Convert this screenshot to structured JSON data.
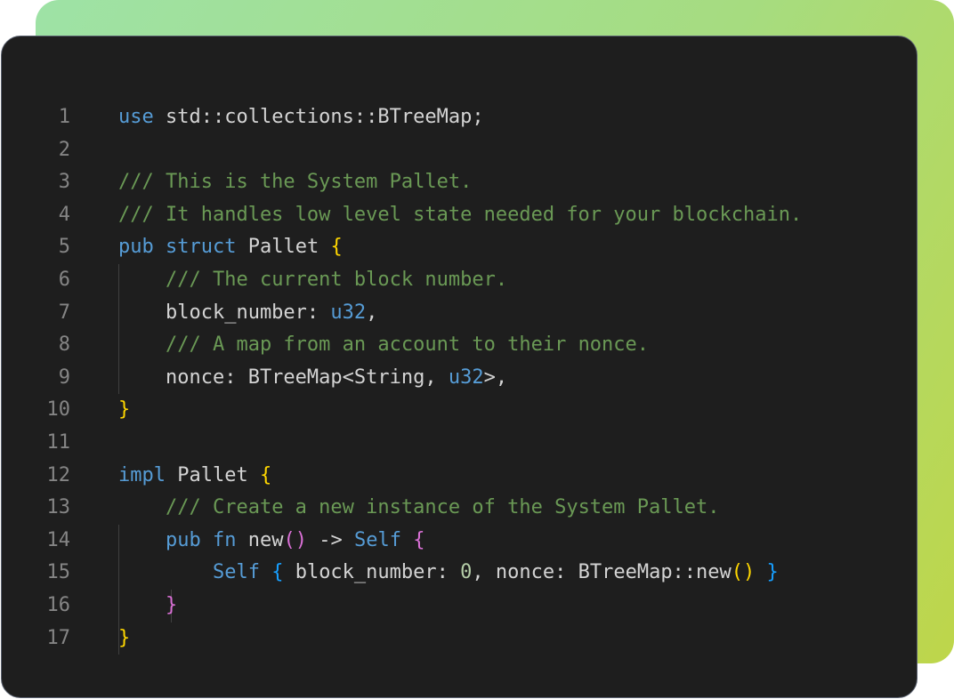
{
  "colors": {
    "background": "#1e1e1e",
    "keyword": "#569cd6",
    "comment": "#6a9955",
    "number": "#b5cea8",
    "text": "#d4d4d4",
    "line_number": "#858585",
    "bracket_level1": "#ffd700",
    "bracket_level2": "#da70d6",
    "bracket_level3": "#179fff"
  },
  "lines": [
    {
      "n": "1",
      "tokens": [
        [
          "kw",
          "use"
        ],
        [
          "plain",
          " std::collections::BTreeMap;"
        ]
      ]
    },
    {
      "n": "2",
      "tokens": []
    },
    {
      "n": "3",
      "tokens": [
        [
          "cm",
          "/// This is the System Pallet."
        ]
      ]
    },
    {
      "n": "4",
      "tokens": [
        [
          "cm",
          "/// It handles low level state needed for your blockchain."
        ]
      ]
    },
    {
      "n": "5",
      "tokens": [
        [
          "kw",
          "pub"
        ],
        [
          "plain",
          " "
        ],
        [
          "kw",
          "struct"
        ],
        [
          "plain",
          " Pallet "
        ],
        [
          "b1",
          "{"
        ]
      ]
    },
    {
      "n": "6",
      "tokens": [
        [
          "plain",
          "    "
        ],
        [
          "cm",
          "/// The current block number."
        ]
      ]
    },
    {
      "n": "7",
      "tokens": [
        [
          "plain",
          "    block_number: "
        ],
        [
          "kw",
          "u32"
        ],
        [
          "plain",
          ","
        ]
      ]
    },
    {
      "n": "8",
      "tokens": [
        [
          "plain",
          "    "
        ],
        [
          "cm",
          "/// A map from an account to their nonce."
        ]
      ]
    },
    {
      "n": "9",
      "tokens": [
        [
          "plain",
          "    nonce: BTreeMap<String, "
        ],
        [
          "kw",
          "u32"
        ],
        [
          "plain",
          ">,"
        ]
      ]
    },
    {
      "n": "10",
      "tokens": [
        [
          "b1",
          "}"
        ]
      ]
    },
    {
      "n": "11",
      "tokens": []
    },
    {
      "n": "12",
      "tokens": [
        [
          "kw",
          "impl"
        ],
        [
          "plain",
          " Pallet "
        ],
        [
          "b1",
          "{"
        ]
      ]
    },
    {
      "n": "13",
      "tokens": [
        [
          "plain",
          "    "
        ],
        [
          "cm",
          "/// Create a new instance of the System Pallet."
        ]
      ]
    },
    {
      "n": "14",
      "tokens": [
        [
          "plain",
          "    "
        ],
        [
          "kw",
          "pub"
        ],
        [
          "plain",
          " "
        ],
        [
          "kw",
          "fn"
        ],
        [
          "plain",
          " new"
        ],
        [
          "b2",
          "()"
        ],
        [
          "plain",
          " -> "
        ],
        [
          "kw",
          "Self"
        ],
        [
          "plain",
          " "
        ],
        [
          "b2",
          "{"
        ]
      ]
    },
    {
      "n": "15",
      "tokens": [
        [
          "plain",
          "        "
        ],
        [
          "kw",
          "Self"
        ],
        [
          "plain",
          " "
        ],
        [
          "b3",
          "{"
        ],
        [
          "plain",
          " block_number: "
        ],
        [
          "num",
          "0"
        ],
        [
          "plain",
          ", nonce: BTreeMap::new"
        ],
        [
          "b1",
          "()"
        ],
        [
          "plain",
          " "
        ],
        [
          "b3",
          "}"
        ]
      ]
    },
    {
      "n": "16",
      "tokens": [
        [
          "plain",
          "    "
        ],
        [
          "b2",
          "}"
        ]
      ]
    },
    {
      "n": "17",
      "tokens": [
        [
          "b1",
          "}"
        ]
      ]
    }
  ]
}
